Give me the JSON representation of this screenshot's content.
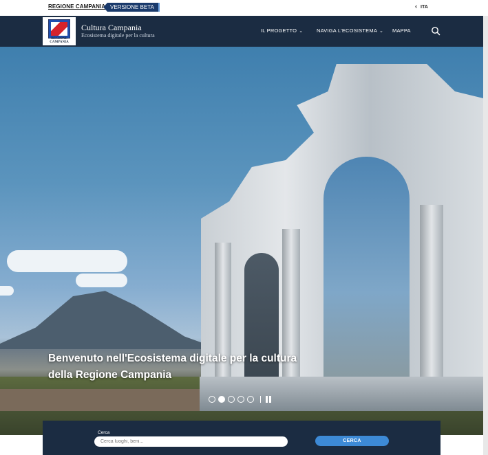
{
  "topbar": {
    "region_link": "REGIONE CAMPANIA",
    "beta_badge": "VERSIONE BETA",
    "language": "ITA"
  },
  "header": {
    "logo_caption": "REGIONE CAMPANIA",
    "title": "Cultura Campania",
    "subtitle": "Ecosistema digitale per la cultura",
    "nav": [
      {
        "label": "IL PROGETTO"
      },
      {
        "label": "NAVIGA L'ECOSISTEMA"
      },
      {
        "label": "MAPPA"
      }
    ]
  },
  "hero": {
    "title": "Benvenuto nell'Ecosistema digitale per la cultura della Regione Campania",
    "slides_count": 5,
    "active_slide": 2
  },
  "search": {
    "label": "Cerca",
    "placeholder": "Cerca luoghi, beni...",
    "button_label": "CERCA"
  },
  "colors": {
    "header_bg": "#1b2c42",
    "accent_button": "#3d8ad6",
    "beta_badge": "#1a3a6b"
  }
}
